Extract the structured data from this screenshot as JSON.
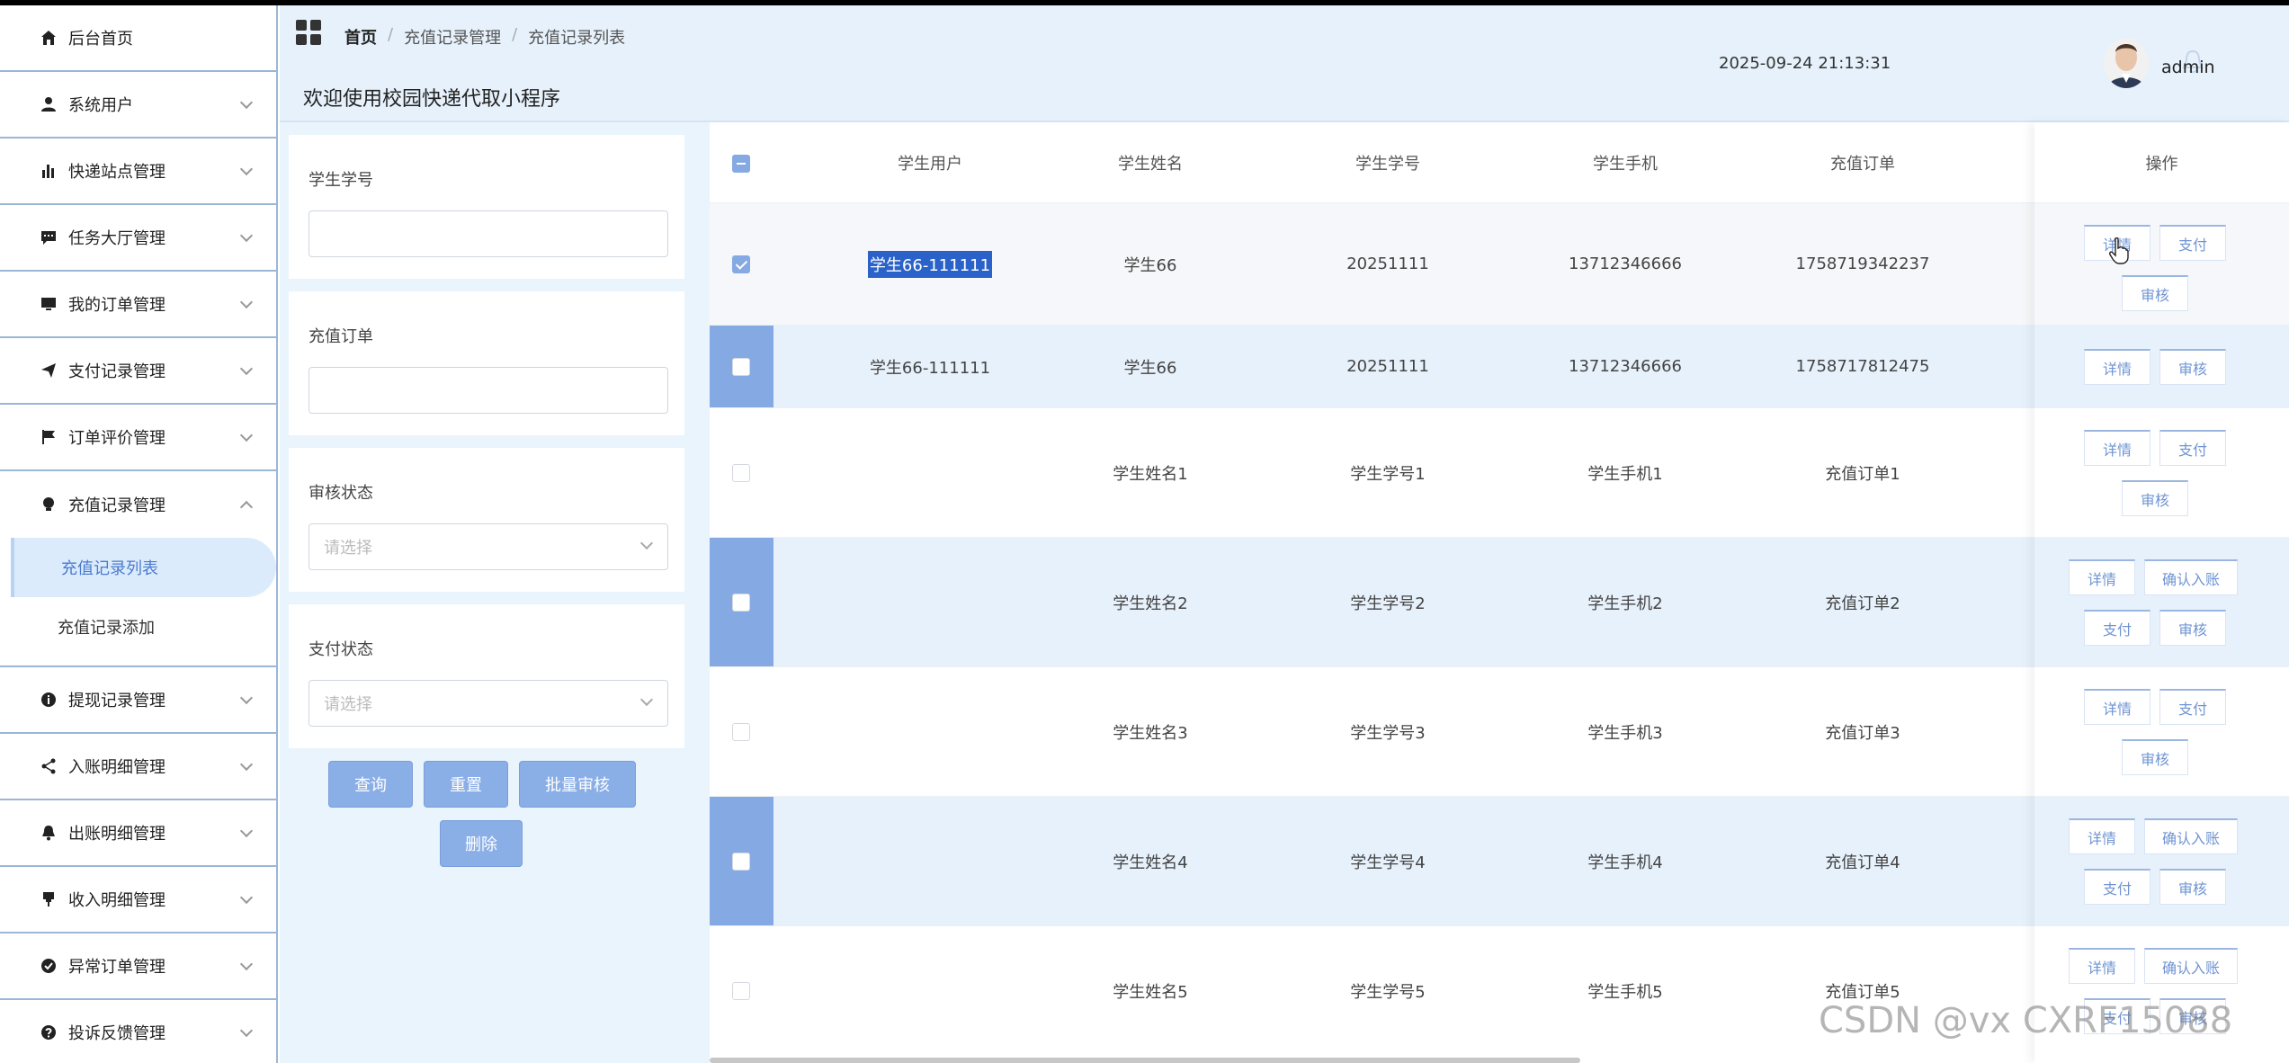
{
  "sidebar": {
    "items": [
      {
        "label": "后台首页",
        "icon": "home-icon",
        "expandable": false
      },
      {
        "label": "系统用户",
        "icon": "user-icon",
        "expandable": true
      },
      {
        "label": "快递站点管理",
        "icon": "bar-chart-icon",
        "expandable": true
      },
      {
        "label": "任务大厅管理",
        "icon": "chat-icon",
        "expandable": true
      },
      {
        "label": "我的订单管理",
        "icon": "monitor-icon",
        "expandable": true
      },
      {
        "label": "支付记录管理",
        "icon": "send-icon",
        "expandable": true
      },
      {
        "label": "订单评价管理",
        "icon": "flag-icon",
        "expandable": true
      },
      {
        "label": "充值记录管理",
        "icon": "bulb-icon",
        "expandable": true,
        "open": true
      },
      {
        "label": "提现记录管理",
        "icon": "info-icon",
        "expandable": true
      },
      {
        "label": "入账明细管理",
        "icon": "share-icon",
        "expandable": true
      },
      {
        "label": "出账明细管理",
        "icon": "bell-icon",
        "expandable": true
      },
      {
        "label": "收入明细管理",
        "icon": "pin-icon",
        "expandable": true
      },
      {
        "label": "异常订单管理",
        "icon": "check-circle-icon",
        "expandable": true
      },
      {
        "label": "投诉反馈管理",
        "icon": "question-icon",
        "expandable": true
      }
    ],
    "submenu": [
      {
        "label": "充值记录列表",
        "active": true
      },
      {
        "label": "充值记录添加",
        "active": false
      }
    ]
  },
  "header": {
    "breadcrumb": [
      "首页",
      "充值记录管理",
      "充值记录列表"
    ],
    "title": "欢迎使用校园快递代取小程序",
    "datetime": "2025-09-24 21:13:31",
    "username": "admin"
  },
  "filters": {
    "student_no_label": "学生学号",
    "student_no_value": "",
    "recharge_order_label": "充值订单",
    "recharge_order_value": "",
    "audit_status_label": "审核状态",
    "audit_status_placeholder": "请选择",
    "pay_status_label": "支付状态",
    "pay_status_placeholder": "请选择",
    "buttons": {
      "query": "查询",
      "reset": "重置",
      "batch_audit": "批量审核",
      "delete": "删除"
    }
  },
  "table": {
    "headers": [
      "学生用户",
      "学生姓名",
      "学生学号",
      "学生手机",
      "充值订单",
      "操作"
    ],
    "rows": [
      {
        "user": "学生66-111111",
        "name": "学生66",
        "no": "20251111",
        "phone": "13712346666",
        "order": "1758719342237",
        "ops": [
          "详情",
          "支付",
          "审核"
        ]
      },
      {
        "user": "学生66-111111",
        "name": "学生66",
        "no": "20251111",
        "phone": "13712346666",
        "order": "1758717812475",
        "ops": [
          "详情",
          "审核"
        ]
      },
      {
        "user": "",
        "name": "学生姓名1",
        "no": "学生学号1",
        "phone": "学生手机1",
        "order": "充值订单1",
        "ops": [
          "详情",
          "支付",
          "审核"
        ]
      },
      {
        "user": "",
        "name": "学生姓名2",
        "no": "学生学号2",
        "phone": "学生手机2",
        "order": "充值订单2",
        "ops": [
          "详情",
          "确认入账",
          "支付",
          "审核"
        ]
      },
      {
        "user": "",
        "name": "学生姓名3",
        "no": "学生学号3",
        "phone": "学生手机3",
        "order": "充值订单3",
        "ops": [
          "详情",
          "支付",
          "审核"
        ]
      },
      {
        "user": "",
        "name": "学生姓名4",
        "no": "学生学号4",
        "phone": "学生手机4",
        "order": "充值订单4",
        "ops": [
          "详情",
          "确认入账",
          "支付",
          "审核"
        ]
      },
      {
        "user": "",
        "name": "学生姓名5",
        "no": "学生学号5",
        "phone": "学生手机5",
        "order": "充值订单5",
        "ops": [
          "详情",
          "确认入账",
          "支付",
          "审核"
        ]
      }
    ]
  },
  "watermark": "CSDN @vx  CXRF15088",
  "colors": {
    "accent": "#85a9e3",
    "header_bg": "#e6f1fb",
    "sidebar_border": "#9bb6d6",
    "button_bg": "#8aaee6"
  }
}
